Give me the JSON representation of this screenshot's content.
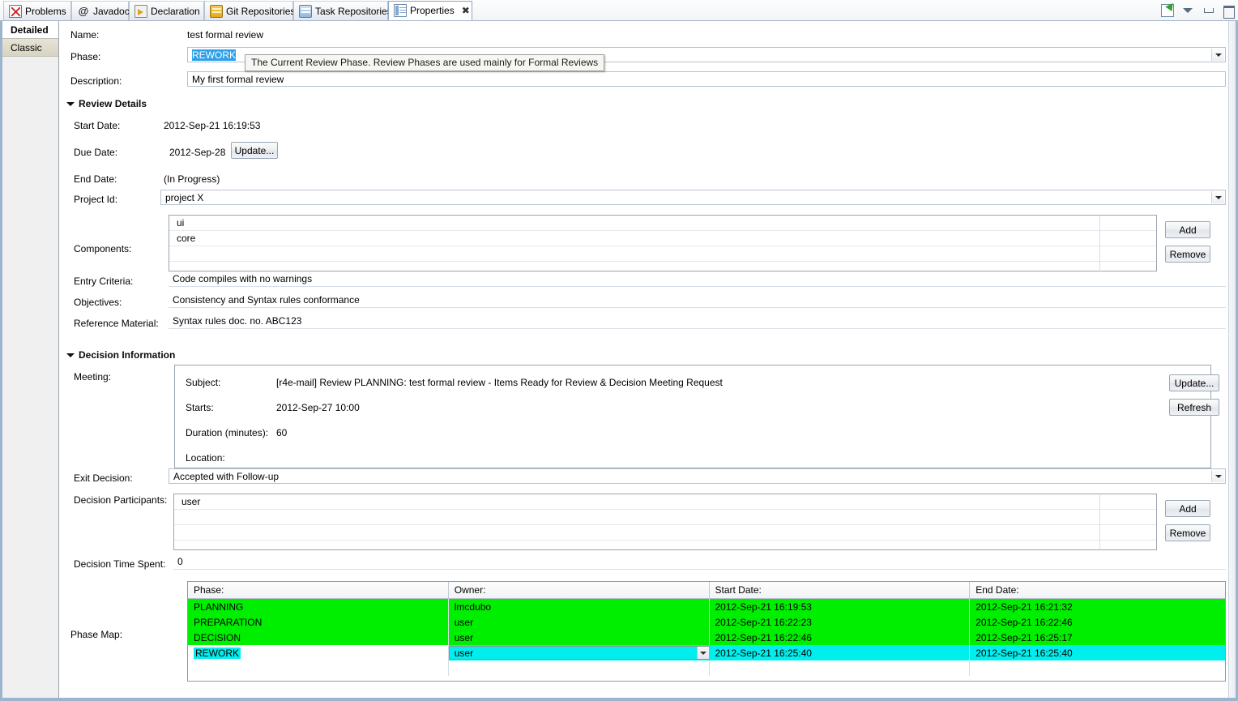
{
  "window": {
    "tabs": [
      {
        "label": "Problems",
        "icon": "problems-icon",
        "active": false
      },
      {
        "label": "Javadoc",
        "icon": "javadoc-icon",
        "active": false
      },
      {
        "label": "Declaration",
        "icon": "declaration-icon",
        "active": false
      },
      {
        "label": "Git Repositories",
        "icon": "git-repositories-icon",
        "active": false
      },
      {
        "label": "Task Repositories",
        "icon": "task-repositories-icon",
        "active": false
      },
      {
        "label": "Properties",
        "icon": "properties-icon",
        "active": true
      }
    ],
    "close_glyph": "✖",
    "controls": [
      {
        "name": "pin-view-icon"
      },
      {
        "name": "view-menu-chevron-icon"
      },
      {
        "name": "minimize-icon"
      },
      {
        "name": "maximize-icon"
      }
    ]
  },
  "sidebar": {
    "items": [
      {
        "label": "Detailed",
        "selected": true
      },
      {
        "label": "Classic",
        "selected": false
      }
    ]
  },
  "form": {
    "name_label": "Name:",
    "name_value": "test formal review",
    "phase_label": "Phase:",
    "phase_value": "REWORK",
    "description_label": "Description:",
    "description_value": "My first formal review",
    "tooltip": "The Current Review Phase.  Review Phases are used mainly for Formal Reviews"
  },
  "review_details": {
    "section_title": "Review Details",
    "start_date_label": "Start Date:",
    "start_date_value": "2012-Sep-21 16:19:53",
    "due_date_label": "Due Date:",
    "due_date_value": "2012-Sep-28",
    "due_date_button": "Update...",
    "end_date_label": "End Date:",
    "end_date_value": "(In Progress)",
    "project_id_label": "Project Id:",
    "project_id_value": "project X",
    "components_label": "Components:",
    "components": [
      "ui",
      "core"
    ],
    "components_add": "Add",
    "components_remove": "Remove",
    "entry_criteria_label": "Entry Criteria:",
    "entry_criteria_value": "Code compiles with no warnings",
    "objectives_label": "Objectives:",
    "objectives_value": "Consistency and Syntax rules conformance",
    "reference_material_label": "Reference Material:",
    "reference_material_value": "Syntax rules doc. no. ABC123"
  },
  "decision_information": {
    "section_title": "Decision Information",
    "meeting_label": "Meeting:",
    "meeting": {
      "subject_label": "Subject:",
      "subject_value": "[r4e-mail]  Review PLANNING: test formal review - Items Ready for Review & Decision Meeting Request",
      "starts_label": "Starts:",
      "starts_value": "2012-Sep-27 10:00",
      "duration_label": "Duration (minutes):",
      "duration_value": "60",
      "location_label": "Location:",
      "location_value": ""
    },
    "meeting_update_button": "Update...",
    "meeting_refresh_button": "Refresh",
    "exit_decision_label": "Exit Decision:",
    "exit_decision_value": "Accepted with Follow-up",
    "decision_participants_label": "Decision Participants:",
    "decision_participants": [
      "user"
    ],
    "participants_add": "Add",
    "participants_remove": "Remove",
    "decision_time_spent_label": "Decision Time Spent:",
    "decision_time_spent_value": "0"
  },
  "phase_map": {
    "label": "Phase Map:",
    "columns": [
      "Phase:",
      "Owner:",
      "Start Date:",
      "End Date:"
    ],
    "rows": [
      {
        "phase": "PLANNING",
        "owner": "lmcdubo",
        "start": "2012-Sep-21 16:19:53",
        "end": "2012-Sep-21 16:21:32",
        "state": "done"
      },
      {
        "phase": "PREPARATION",
        "owner": "user",
        "start": "2012-Sep-21 16:22:23",
        "end": "2012-Sep-21 16:22:46",
        "state": "done"
      },
      {
        "phase": "DECISION",
        "owner": "user",
        "start": "2012-Sep-21 16:22:46",
        "end": "2012-Sep-21 16:25:17",
        "state": "done"
      },
      {
        "phase": "REWORK",
        "owner": "user",
        "start": "2012-Sep-21 16:25:40",
        "end": "2012-Sep-21 16:25:40",
        "state": "current"
      }
    ]
  },
  "colors": {
    "done_green": "#00ee00",
    "current_cyan": "#00eeee",
    "selection_blue": "#2e9fe8",
    "frame_blue": "#9db4cf"
  }
}
